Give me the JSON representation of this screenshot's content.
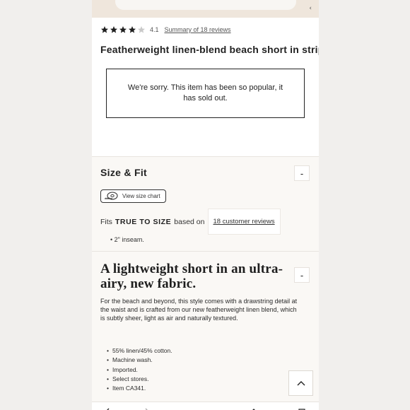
{
  "product": {
    "rating": 4.1,
    "rating_label": "4.1",
    "reviews_link": "Summary of 18 reviews",
    "title": "Featherweight linen-blend beach short in stripe",
    "sold_out_message": "We're sorry. This item has been so popular, it has sold out."
  },
  "size_fit": {
    "heading": "Size & Fit",
    "collapse_symbol": "-",
    "size_chart_label": "View size chart",
    "fits_prefix": "Fits",
    "fits_value": "TRUE TO SIZE",
    "fits_suffix": "based on",
    "customer_reviews_link": "18 customer reviews",
    "inseam": "2\" inseam."
  },
  "description": {
    "heading": "A lightweight short in an ultra-airy, new fabric.",
    "collapse_symbol": "-",
    "body": "For the beach and beyond, this style comes with a drawstring detail at the waist and is crafted from our new featherweight linen blend, which is subtly sheer, light as air and naturally textured.",
    "bullets": [
      "55% linen/45% cotton.",
      "Machine wash.",
      "Imported.",
      "Select stores.",
      "Item CA341."
    ]
  },
  "icons": {
    "star": "star-icon",
    "tape": "measuring-tape-icon",
    "scroll_top": "chevron-up-icon"
  },
  "colors": {
    "page_bg": "#f1efed",
    "header_band": "#efe6dc",
    "section_bg": "#faf8f5",
    "star_filled": "#1f1f1f",
    "star_empty": "#c9c9c9"
  }
}
